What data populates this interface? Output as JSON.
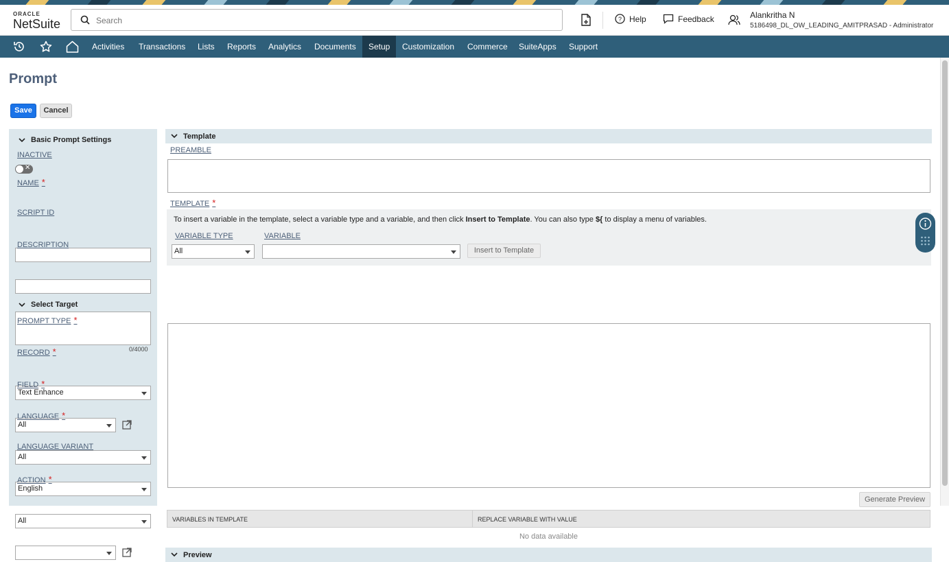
{
  "header": {
    "logo_top": "ORACLE",
    "logo_bottom": "NetSuite",
    "search_placeholder": "Search",
    "help_label": "Help",
    "feedback_label": "Feedback",
    "user_name": "Alankritha N",
    "user_role": "5186498_DL_OW_LEADING_AMITPRASAD - Administrator"
  },
  "nav": {
    "items": [
      "Activities",
      "Transactions",
      "Lists",
      "Reports",
      "Analytics",
      "Documents",
      "Setup",
      "Customization",
      "Commerce",
      "SuiteApps",
      "Support"
    ],
    "active": "Setup"
  },
  "page": {
    "title": "Prompt",
    "save_label": "Save",
    "cancel_label": "Cancel"
  },
  "basic": {
    "section_title": "Basic Prompt Settings",
    "inactive_label": "INACTIVE",
    "name_label": "NAME",
    "script_id_label": "SCRIPT ID",
    "description_label": "DESCRIPTION",
    "counter": "0/4000"
  },
  "target": {
    "section_title": "Select Target",
    "prompt_type_label": "PROMPT TYPE",
    "prompt_type_value": "Text Enhance",
    "record_label": "RECORD",
    "record_value": "All",
    "field_label": "FIELD",
    "field_value": "All",
    "language_label": "LANGUAGE",
    "language_value": "English",
    "language_variant_label": "LANGUAGE VARIANT",
    "language_variant_value": "All",
    "action_label": "ACTION",
    "action_value": ""
  },
  "template": {
    "section_title": "Template",
    "preamble_label": "PREAMBLE",
    "template_label": "TEMPLATE",
    "info_part1": "To insert a variable in the template, select a variable type and a variable, and then click ",
    "info_bold1": "Insert to Template",
    "info_part2": ". You can also type ",
    "info_bold2": "${",
    "info_part3": " to display a menu of variables.",
    "variable_type_label": "VARIABLE TYPE",
    "variable_type_value": "All",
    "variable_label": "VARIABLE",
    "variable_value": "",
    "insert_button": "Insert to Template",
    "generate_preview_button": "Generate Preview",
    "col_variables": "VARIABLES IN TEMPLATE",
    "col_replace": "REPLACE VARIABLE WITH VALUE",
    "no_data": "No data available"
  },
  "preview": {
    "section_title": "Preview"
  },
  "colors": {
    "nav_bg": "#2f5f7a",
    "nav_active": "#1c3a4c",
    "panel_bg": "#dce7ec",
    "save_blue": "#1a73e8",
    "label_blue": "#4d6079",
    "required_red": "#d41e1e"
  }
}
